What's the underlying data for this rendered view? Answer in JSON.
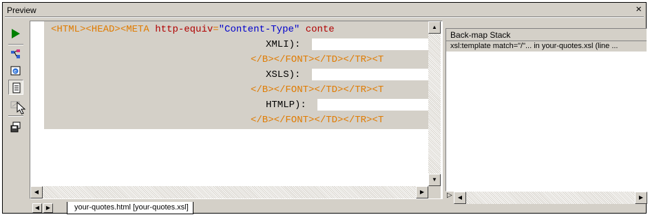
{
  "window": {
    "title": "Preview",
    "close_symbol": "×"
  },
  "toolbar": {
    "icons": [
      "play-icon",
      "map-icon",
      "browser-icon",
      "document-icon",
      "disabled-icon",
      "save-icon"
    ]
  },
  "code": {
    "lines": [
      {
        "segments": [
          {
            "cls": "tag",
            "text": "<HTML><HEAD><META "
          },
          {
            "cls": "attr",
            "text": "http-equiv"
          },
          {
            "cls": "tag",
            "text": "="
          },
          {
            "cls": "str",
            "text": "\"Content-Type\""
          },
          {
            "cls": "txt",
            "text": " "
          },
          {
            "cls": "attr",
            "text": "conte"
          }
        ]
      },
      {
        "segments": [
          {
            "cls": "txt",
            "text": "XMLI):"
          }
        ]
      },
      {
        "segments": [
          {
            "cls": "tag",
            "text": "</B></FONT></TD></TR><T"
          }
        ]
      },
      {
        "segments": [
          {
            "cls": "txt",
            "text": "XSLS):"
          }
        ]
      },
      {
        "segments": [
          {
            "cls": "tag",
            "text": "</B></FONT></TD></TR><T"
          }
        ]
      },
      {
        "segments": [
          {
            "cls": "txt",
            "text": "HTMLP):"
          }
        ]
      },
      {
        "segments": [
          {
            "cls": "tag",
            "text": "</B></FONT></TD></TR><T"
          }
        ]
      }
    ]
  },
  "tabs": {
    "active_label": "your-quotes.html [your-quotes.xsl]"
  },
  "backmap": {
    "header": "Back-map Stack",
    "rows": [
      "xsl:template match=\"/\"... in your-quotes.xsl (line ..."
    ]
  }
}
